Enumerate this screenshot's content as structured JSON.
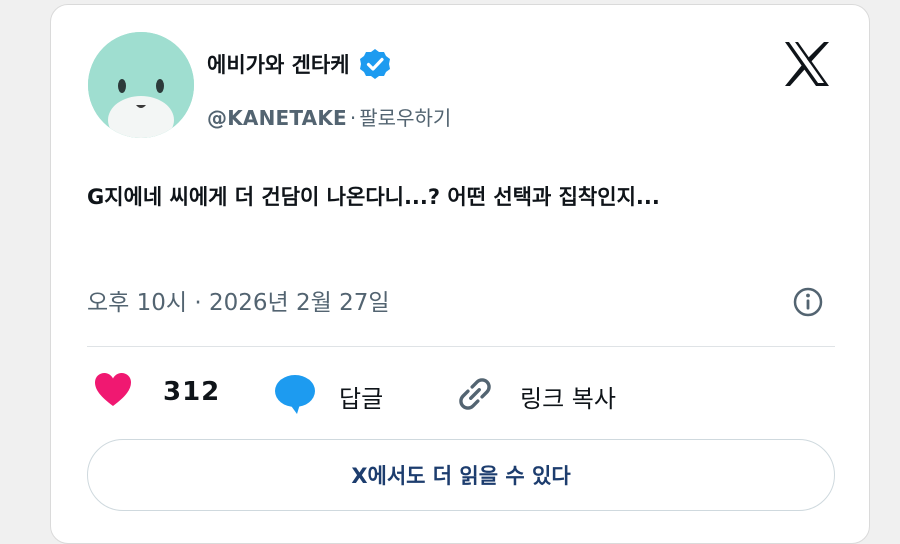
{
  "author": {
    "name": "에비가와 겐타케",
    "handle": "@KANETAKE",
    "separator": "·",
    "follow_label": "팔로우하기"
  },
  "tweet": {
    "text": "G지에네 씨에게 더 건담이 나온다니...? 어떤 선택과 집착인지...",
    "timestamp": "오후 10시 · 2026년 2월 27일"
  },
  "actions": {
    "like_count": "312",
    "reply_label": "답글",
    "copy_link_label": "링크 복사"
  },
  "read_more_label": "X에서도 더 읽을 수 있다",
  "colors": {
    "verified": "#1d9bf0",
    "heart": "#f01871",
    "reply_bubble": "#1d9bf0",
    "avatar_bg": "#9fded0"
  },
  "icons": [
    "verified-badge-icon",
    "x-logo-icon",
    "info-icon",
    "heart-icon",
    "reply-bubble-icon",
    "link-icon"
  ]
}
